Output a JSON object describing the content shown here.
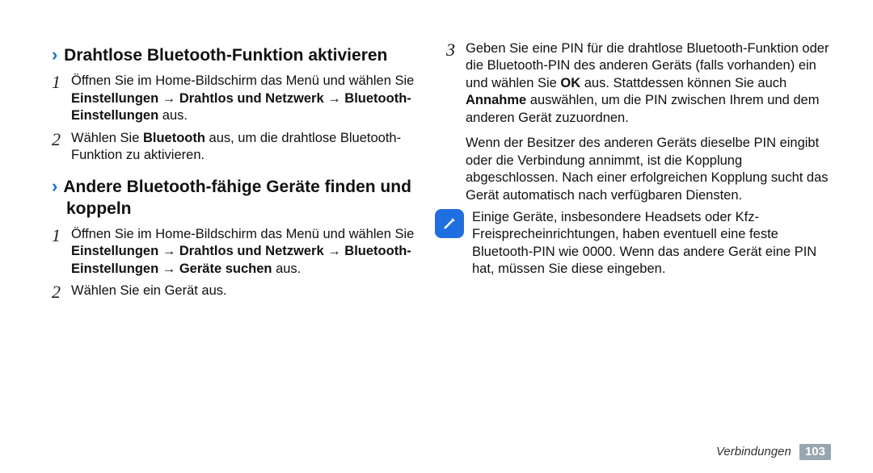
{
  "left": {
    "section1": {
      "title": "Drahtlose Bluetooth-Funktion aktivieren",
      "step1_plain": "Öffnen Sie im Home-Bildschirm das Menü und wählen Sie ",
      "step1_bold": "Einstellungen → Drahtlos und Netzwerk → Bluetooth-Einstellungen",
      "step1_tail": " aus.",
      "step2_a": "Wählen Sie ",
      "step2_b": "Bluetooth",
      "step2_c": " aus, um die drahtlose Bluetooth-Funktion zu aktivieren."
    },
    "section2": {
      "title": "Andere Bluetooth-fähige Geräte finden und koppeln",
      "step1_plain": "Öffnen Sie im Home-Bildschirm das Menü und wählen Sie ",
      "step1_bold": "Einstellungen → Drahtlos und Netzwerk → Bluetooth-Einstellungen → Geräte suchen",
      "step1_tail": " aus.",
      "step2": "Wählen Sie ein Gerät aus."
    }
  },
  "right": {
    "step3_num": "3",
    "step3_part1a": "Geben Sie eine PIN für die drahtlose Bluetooth-Funktion oder die Bluetooth-PIN des anderen Geräts (falls vorhanden) ein und wählen Sie ",
    "step3_ok": "OK",
    "step3_part1b": " aus. Stattdessen können Sie auch ",
    "step3_annahme": "Annahme",
    "step3_part1c": " auswählen, um die PIN zwischen Ihrem und dem anderen Gerät zuzuordnen.",
    "step3_para2": "Wenn der Besitzer des anderen Geräts dieselbe PIN eingibt oder die Verbindung annimmt, ist die Kopplung abgeschlossen. Nach einer erfolgreichen Kopplung sucht das Gerät automatisch nach verfügbaren Diensten.",
    "note": "Einige Geräte, insbesondere Headsets oder Kfz-Freisprecheinrichtungen, haben eventuell eine feste Bluetooth-PIN wie 0000. Wenn das andere Gerät eine PIN hat, müssen Sie diese eingeben."
  },
  "footer": {
    "section": "Verbindungen",
    "page": "103"
  },
  "nums": {
    "n1": "1",
    "n2": "2"
  }
}
